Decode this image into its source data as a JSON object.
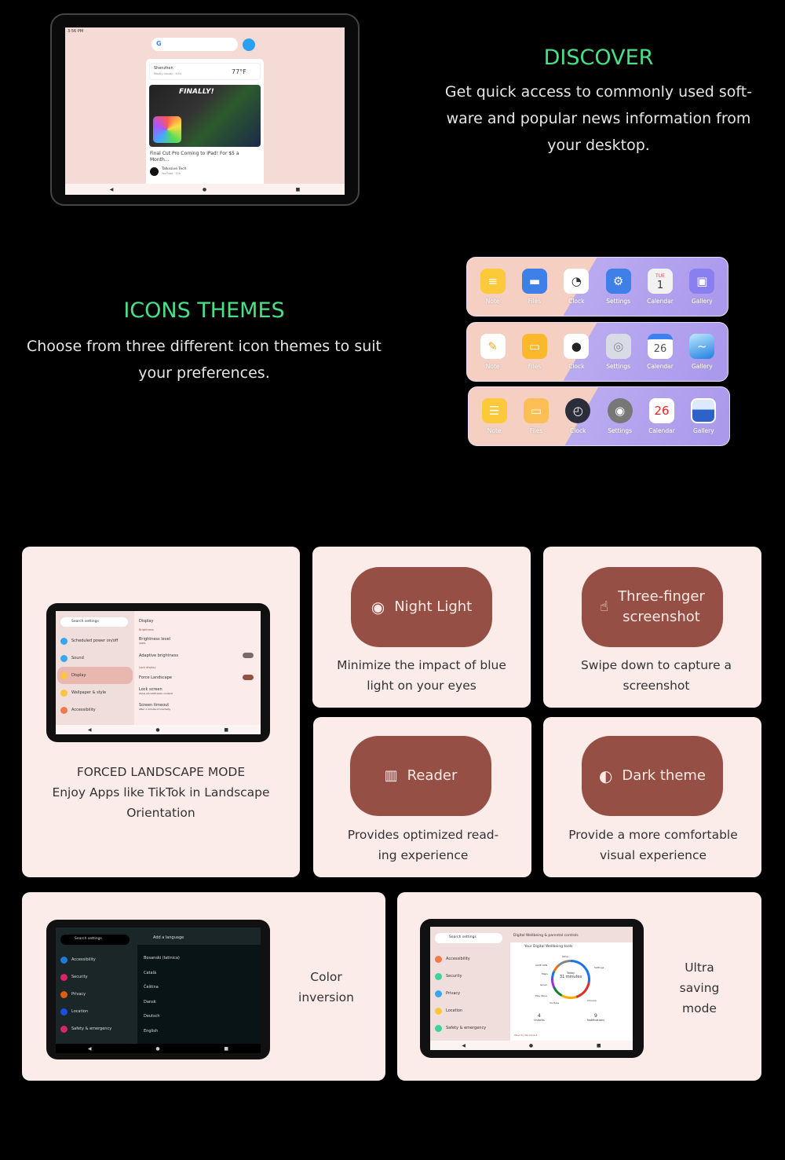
{
  "discover": {
    "title": "DISCOVER",
    "body_lines": [
      "Get quick access to commonly used soft-",
      "ware and popular news information from",
      "your desktop."
    ],
    "screen": {
      "time": "3:56 PM",
      "city": "Shenzhen",
      "weather": "Mostly cloudy · 40%",
      "temp": "77°F",
      "thumb_text": "FINALLY!",
      "headline": "Final Cut Pro Coming to iPad! For $5 a Month...",
      "channel": "Talkssive Tech",
      "source": "YouTube · 11h"
    }
  },
  "icons": {
    "title": "ICONS THEMES",
    "body_lines": [
      "Choose from three different icon themes to suit",
      "your preferences."
    ],
    "labels": [
      "Note",
      "Files",
      "Clock",
      "Settings",
      "Calendar",
      "Gallery"
    ],
    "calendar_values": [
      {
        "day": "TUE",
        "date": "1"
      },
      {
        "date": "26"
      },
      {
        "date": "26"
      }
    ]
  },
  "landscape": {
    "title": "FORCED LANDSCAPE MODE",
    "body_lines": [
      "Enjoy Apps like TikTok in Landscape",
      "Orientation"
    ],
    "screen": {
      "search": "Search settings",
      "menu": [
        "Scheduled power on/off",
        "Sound",
        "Display",
        "Wallpaper & style",
        "Accessibility"
      ],
      "header": "Display",
      "section1": "Brightness",
      "items": [
        {
          "t": "Brightness level",
          "s": "100%"
        },
        {
          "t": "Adaptive brightness",
          "s": ""
        }
      ],
      "section2": "Lock display",
      "items2": [
        {
          "t": "Force Landscape",
          "s": ""
        },
        {
          "t": "Lock screen",
          "s": "Show all notification content"
        },
        {
          "t": "Screen timeout",
          "s": "After 1 minute of inactivity"
        }
      ],
      "adaptive_on": false,
      "force_on": true
    }
  },
  "features": [
    {
      "label": "Night Light",
      "icon": "eye-icon",
      "desc_lines": [
        "Minimize the impact of blue",
        "light on your eyes"
      ]
    },
    {
      "label_lines": [
        "Three-finger",
        "screenshot"
      ],
      "icon": "three-finger-swipe-icon",
      "desc_lines": [
        "Swipe down to capture a",
        "screenshot"
      ]
    },
    {
      "label": "Reader",
      "icon": "book-icon",
      "desc_lines": [
        "Provides optimized read-",
        "ing experience"
      ]
    },
    {
      "label": "Dark theme",
      "icon": "half-circle-icon",
      "desc_lines": [
        "Provide a more comfortable",
        "visual experience"
      ]
    }
  ],
  "color_inversion": {
    "label_lines": [
      "Color",
      "inversion"
    ],
    "screen": {
      "search": "Search settings",
      "menu": [
        "Accessibility",
        "Security",
        "Privacy",
        "Location",
        "Safety & emergency"
      ],
      "header": "Add a language",
      "languages": [
        "Bosanski (latinica)",
        "Català",
        "Čeština",
        "Dansk",
        "Deutsch",
        "English"
      ]
    }
  },
  "ultra_saving": {
    "label_lines": [
      "Ultra",
      "saving",
      "mode"
    ],
    "screen": {
      "search": "Search settings",
      "menu": [
        "Accessibility",
        "Security",
        "Privacy",
        "Location",
        "Safety & emergency"
      ],
      "header": "Digital Wellbeing & parental controls",
      "tools": "Your Digital Wellbeing tools",
      "today": "Today",
      "minutes": "31 minutes",
      "segments": [
        "Other",
        "AdrIE VPN",
        "Maps",
        "Gmail",
        "Play Store",
        "YouTube",
        "Chrome",
        "Settings"
      ],
      "unlocks": "4",
      "unlocks_label": "Unlocks",
      "notifications": "9",
      "notifications_label": "Notifications",
      "link": "Ways to disconnect"
    }
  },
  "colors": {
    "accent": "#49e08a",
    "card": "#fbecea",
    "pill": "#954f44"
  }
}
